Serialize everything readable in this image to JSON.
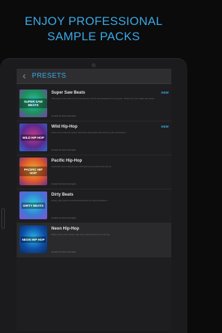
{
  "headline": {
    "line1": "ENJOY PROFESSIONAL",
    "line2": "SAMPLE PACKS"
  },
  "appbar": {
    "back_glyph": "‹",
    "title": "PRESETS"
  },
  "presets": [
    {
      "title": "Super Saw Beats",
      "art_text": "SUPER SAW BEATS",
      "badge": "new",
      "desc": "This pack comes with a lot of instruments, drums and samples from the genre. Perfect for your tracks and beats.",
      "credit": "created by Fred Lamington",
      "art_colors": [
        "#1f8f5a",
        "#24c3b5",
        "#7c3ab8"
      ]
    },
    {
      "title": "Wild Hip-Hop",
      "art_text": "WILD HIP HOP",
      "badge": "new",
      "desc": "Grab a set of hip-hop beats, bass lines and classic drum kits for your productions.",
      "credit": "created by Fred Lamington",
      "art_colors": [
        "#5b2a8c",
        "#c23b8f",
        "#2a6bd6"
      ]
    },
    {
      "title": "Pacific Hip-Hop",
      "art_text": "PACIFIC HIP HOP",
      "badge": "",
      "desc": "Laid back west coast grooves with warm keys and punchy drums.",
      "credit": "created by Fred Lamington",
      "art_colors": [
        "#e0592a",
        "#e8b23a",
        "#6b2d8e"
      ]
    },
    {
      "title": "Dirty Beats",
      "art_text": "DIRTY BEATS",
      "badge": "",
      "desc": "Heavy, gritty drums and distorted basses for raw productions.",
      "credit": "created by Fred Lamington",
      "art_colors": [
        "#3a7bd5",
        "#2ad1d9",
        "#8a4fd3"
      ]
    },
    {
      "title": "Neon Hip-Hop",
      "art_text": "NEON HIP HOP",
      "badge": "",
      "desc": "Bright synths and modern trap drums glowing with neon energy.",
      "credit": "created by Fred Lamington",
      "art_colors": [
        "#0f4fa8",
        "#27b6e8",
        "#0b2a5a"
      ]
    }
  ],
  "colors": {
    "accent": "#3ba9e6",
    "background": "#0b0b0c",
    "panel": "#1e1e20"
  }
}
